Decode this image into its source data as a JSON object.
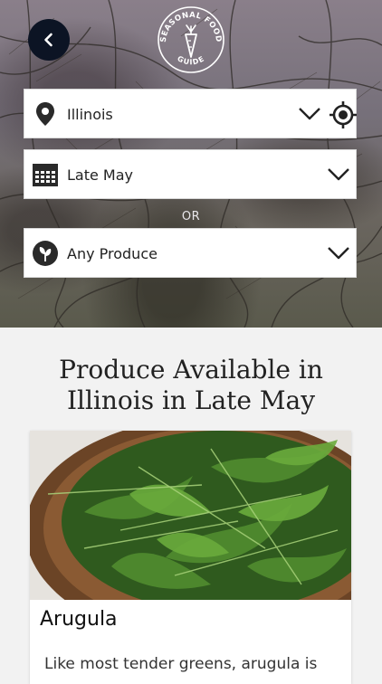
{
  "header": {
    "logo_text": "SEASONAL FOOD GUIDE",
    "logo_line1": "SEASONAL FOOD",
    "logo_line2": "GUIDE",
    "back_icon": "chevron-left-icon"
  },
  "filters": {
    "location": {
      "value": "Illinois",
      "icon": "map-pin-icon",
      "action_icon": "crosshair-icon"
    },
    "time": {
      "value": "Late May",
      "icon": "calendar-icon"
    },
    "separator": "OR",
    "produce": {
      "value": "Any Produce",
      "icon": "produce-icon"
    }
  },
  "main": {
    "heading_line1": "Produce Available in",
    "heading_line2": "Illinois in Late May"
  },
  "card": {
    "title": "Arugula",
    "description": "Like most tender greens, arugula is"
  },
  "colors": {
    "back_button": "#0c1424",
    "heading": "#222222",
    "page_bg": "#f2f2f2"
  }
}
